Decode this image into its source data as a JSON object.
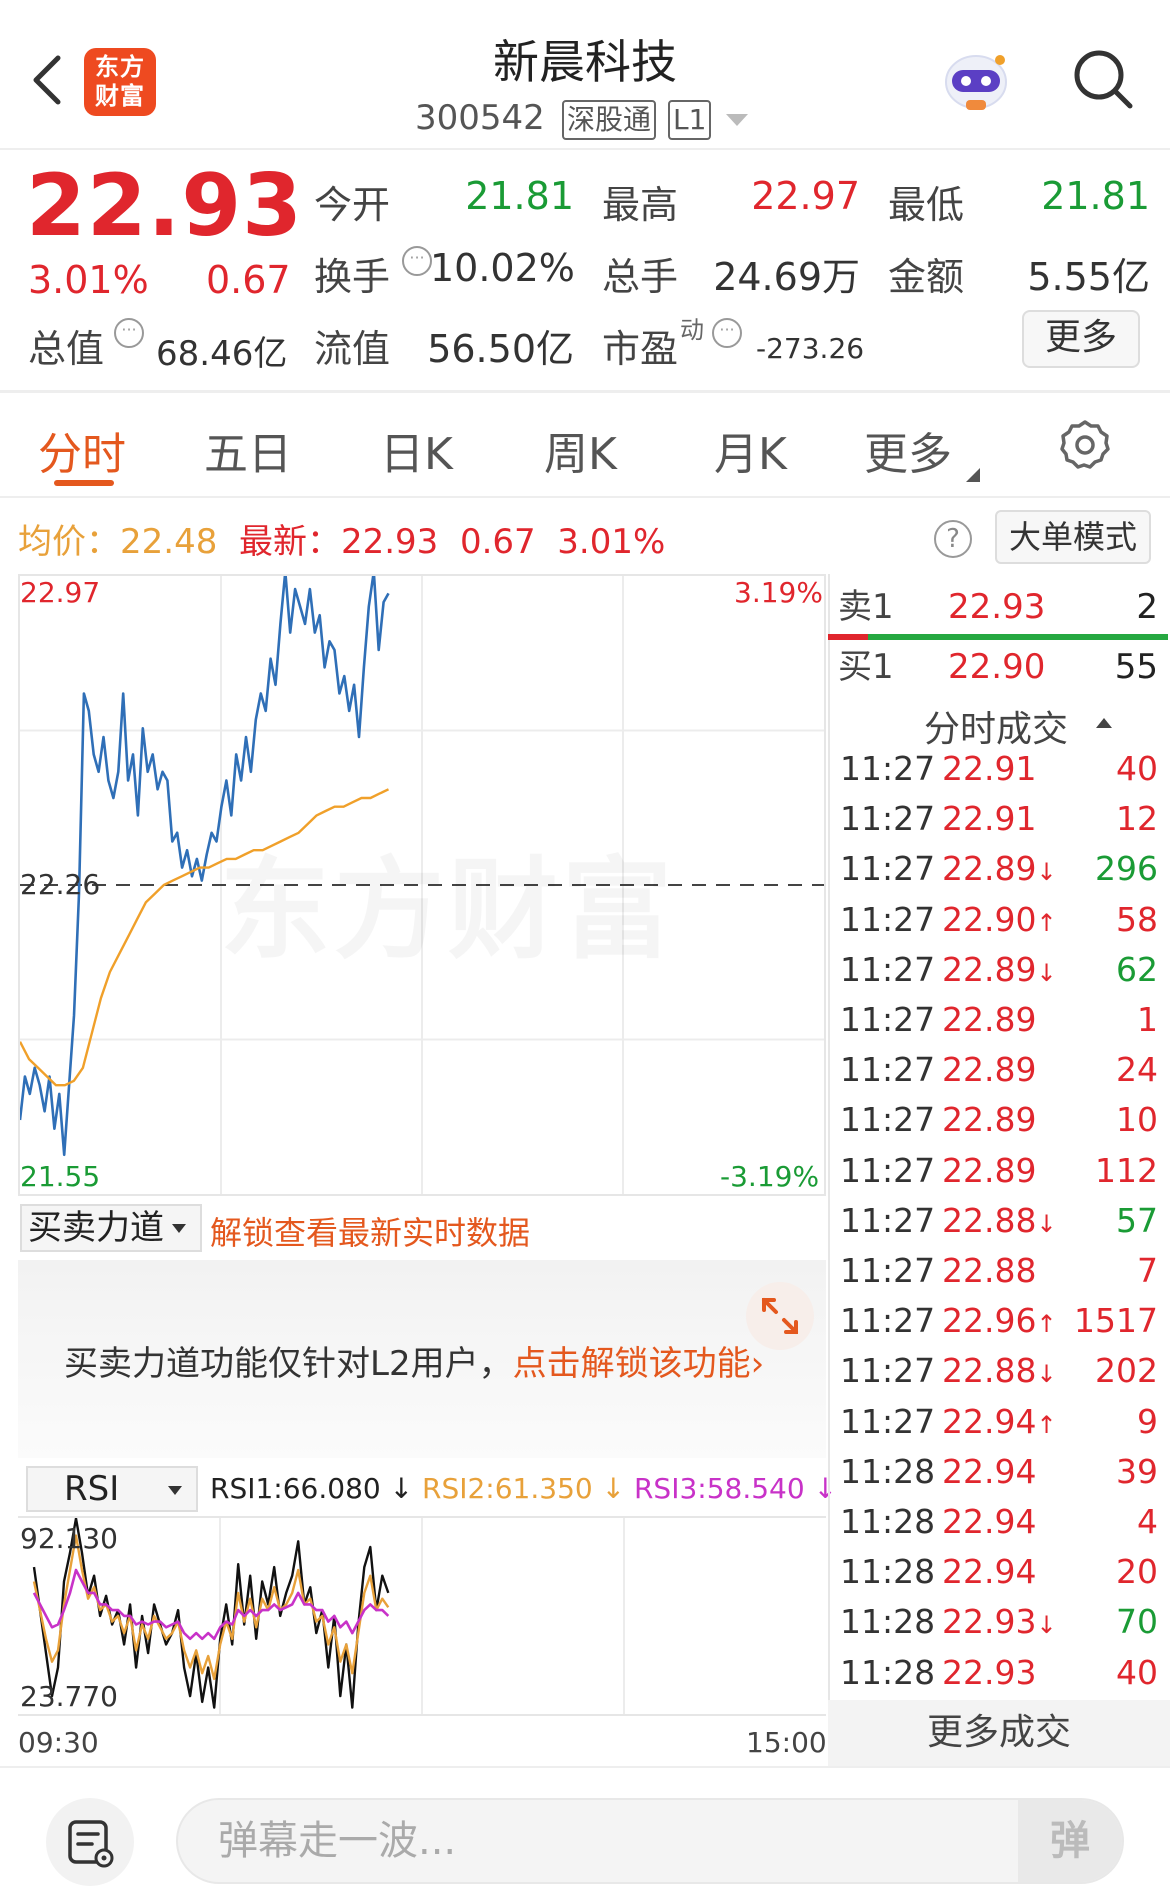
{
  "header": {
    "logo_text": "东方财富",
    "stock_name": "新晨科技",
    "stock_code": "300542",
    "tag_sgt": "深股通",
    "tag_level": "L1"
  },
  "quote": {
    "price": "22.93",
    "change_pct": "3.01%",
    "change_amt": "0.67",
    "labels": {
      "open": "今开",
      "high": "最高",
      "low": "最低",
      "turnover": "换手",
      "volume": "总手",
      "amount": "金额",
      "mktcap": "总值",
      "float_cap": "流值",
      "pe": "市盈",
      "pe_sup": "动"
    },
    "values": {
      "open": "21.81",
      "high": "22.97",
      "low": "21.81",
      "turnover": "10.02%",
      "volume": "24.69万",
      "amount": "5.55亿",
      "mktcap": "68.46亿",
      "float_cap": "56.50亿",
      "pe": "-273.26"
    },
    "more_label": "更多"
  },
  "tabs": [
    "分时",
    "五日",
    "日K",
    "周K",
    "月K",
    "更多"
  ],
  "summary": {
    "avg_label": "均价：",
    "avg_value": "22.48",
    "latest_label": "最新：",
    "latest_value": "22.93",
    "latest_change": "0.67",
    "latest_pct": "3.01%",
    "help_icon": "?",
    "bigorder_label": "大单模式"
  },
  "chart_data": {
    "type": "line",
    "y_max": "22.97",
    "y_min": "21.55",
    "y_ref": "22.26",
    "pct_max": "3.19%",
    "pct_min": "-3.19%",
    "ylim": [
      21.55,
      22.97
    ],
    "reference": 22.26,
    "x_start": "09:30",
    "x_end": "15:00",
    "series": [
      {
        "color": "#2f6fb7",
        "values": [
          21.72,
          21.82,
          21.78,
          21.84,
          21.8,
          21.74,
          21.82,
          21.7,
          21.78,
          21.64,
          21.8,
          21.96,
          22.24,
          22.7,
          22.66,
          22.56,
          22.52,
          22.6,
          22.5,
          22.46,
          22.52,
          22.7,
          22.5,
          22.56,
          22.42,
          22.62,
          22.52,
          22.56,
          22.48,
          22.52,
          22.5,
          22.36,
          22.38,
          22.3,
          22.34,
          22.28,
          22.32,
          22.27,
          22.33,
          22.38,
          22.36,
          22.44,
          22.5,
          22.42,
          22.56,
          22.5,
          22.6,
          22.52,
          22.64,
          22.7,
          22.66,
          22.78,
          22.72,
          22.86,
          22.98,
          22.84,
          22.94,
          22.9,
          22.86,
          22.94,
          22.84,
          22.88,
          22.76,
          22.82,
          22.8,
          22.7,
          22.74,
          22.66,
          22.72,
          22.6,
          22.76,
          22.9,
          22.98,
          22.8,
          22.91,
          22.93
        ]
      },
      {
        "color": "#f0a02a",
        "values": [
          21.9,
          21.86,
          21.84,
          21.82,
          21.8,
          21.8,
          21.81,
          21.84,
          21.92,
          22.0,
          22.06,
          22.1,
          22.14,
          22.18,
          22.22,
          22.24,
          22.26,
          22.27,
          22.28,
          22.29,
          22.3,
          22.3,
          22.31,
          22.32,
          22.32,
          22.33,
          22.34,
          22.34,
          22.35,
          22.36,
          22.37,
          22.38,
          22.4,
          22.42,
          22.43,
          22.44,
          22.44,
          22.45,
          22.46,
          22.46,
          22.47,
          22.48
        ]
      }
    ]
  },
  "bsf": {
    "select_label": "买卖力道",
    "unlock_link": "解锁查看最新实时数据",
    "msg": "买卖力道功能仅针对L2用户，",
    "msg_link": "点击解锁该功能",
    "msg_arrow": "›"
  },
  "rsi": {
    "select_label": "RSI",
    "rsi1": "RSI1:66.080 ↓",
    "rsi2": "RSI2:61.350 ↓",
    "rsi3": "RSI3:58.540 ↓",
    "y_max": "92.130",
    "y_min": "23.770",
    "colors": {
      "rsi1": "#111111",
      "rsi2": "#e8a13a",
      "rsi3": "#c832c8"
    },
    "series": [
      {
        "name": "RSI1",
        "values": [
          75,
          60,
          45,
          30,
          40,
          70,
          80,
          92,
          80,
          65,
          72,
          58,
          65,
          55,
          60,
          48,
          62,
          40,
          58,
          45,
          62,
          55,
          48,
          52,
          60,
          40,
          30,
          45,
          28,
          40,
          26,
          50,
          62,
          48,
          76,
          55,
          72,
          50,
          70,
          62,
          75,
          58,
          66,
          72,
          84,
          62,
          68,
          52,
          60,
          40,
          58,
          30,
          48,
          26,
          55,
          75,
          82,
          60,
          72,
          66
        ]
      },
      {
        "name": "RSI2",
        "values": [
          70,
          60,
          50,
          42,
          46,
          62,
          74,
          86,
          74,
          64,
          68,
          60,
          62,
          56,
          58,
          52,
          58,
          46,
          55,
          50,
          58,
          54,
          50,
          52,
          56,
          46,
          40,
          46,
          38,
          44,
          36,
          48,
          56,
          50,
          66,
          56,
          64,
          54,
          64,
          60,
          68,
          60,
          62,
          66,
          74,
          62,
          64,
          56,
          58,
          48,
          54,
          42,
          48,
          38,
          52,
          66,
          72,
          60,
          64,
          61
        ]
      },
      {
        "name": "RSI3",
        "values": [
          66,
          62,
          58,
          54,
          55,
          60,
          66,
          74,
          70,
          66,
          66,
          62,
          62,
          60,
          60,
          58,
          58,
          55,
          56,
          55,
          56,
          56,
          54,
          55,
          56,
          52,
          50,
          52,
          50,
          52,
          50,
          54,
          56,
          55,
          60,
          58,
          60,
          58,
          60,
          60,
          62,
          60,
          61,
          62,
          66,
          62,
          62,
          60,
          60,
          56,
          58,
          54,
          56,
          52,
          56,
          60,
          62,
          60,
          60,
          58
        ]
      }
    ]
  },
  "orderbook": {
    "sell": {
      "label": "卖1",
      "price": "22.93",
      "vol": "2"
    },
    "buy": {
      "label": "买1",
      "price": "22.90",
      "vol": "55"
    }
  },
  "trades": {
    "title": "分时成交",
    "rows": [
      {
        "time": "11:27",
        "price": "22.91",
        "arrow": "",
        "vol": "40",
        "dir": "up"
      },
      {
        "time": "11:27",
        "price": "22.91",
        "arrow": "",
        "vol": "12",
        "dir": "up"
      },
      {
        "time": "11:27",
        "price": "22.89",
        "arrow": "↓",
        "vol": "296",
        "dir": "down"
      },
      {
        "time": "11:27",
        "price": "22.90",
        "arrow": "↑",
        "vol": "58",
        "dir": "up"
      },
      {
        "time": "11:27",
        "price": "22.89",
        "arrow": "↓",
        "vol": "62",
        "dir": "down"
      },
      {
        "time": "11:27",
        "price": "22.89",
        "arrow": "",
        "vol": "1",
        "dir": "up"
      },
      {
        "time": "11:27",
        "price": "22.89",
        "arrow": "",
        "vol": "24",
        "dir": "up"
      },
      {
        "time": "11:27",
        "price": "22.89",
        "arrow": "",
        "vol": "10",
        "dir": "up"
      },
      {
        "time": "11:27",
        "price": "22.89",
        "arrow": "",
        "vol": "112",
        "dir": "up"
      },
      {
        "time": "11:27",
        "price": "22.88",
        "arrow": "↓",
        "vol": "57",
        "dir": "down"
      },
      {
        "time": "11:27",
        "price": "22.88",
        "arrow": "",
        "vol": "7",
        "dir": "up"
      },
      {
        "time": "11:27",
        "price": "22.96",
        "arrow": "↑",
        "vol": "1517",
        "dir": "up"
      },
      {
        "time": "11:27",
        "price": "22.88",
        "arrow": "↓",
        "vol": "202",
        "dir": "up"
      },
      {
        "time": "11:27",
        "price": "22.94",
        "arrow": "↑",
        "vol": "9",
        "dir": "up"
      },
      {
        "time": "11:28",
        "price": "22.94",
        "arrow": "",
        "vol": "39",
        "dir": "up"
      },
      {
        "time": "11:28",
        "price": "22.94",
        "arrow": "",
        "vol": "4",
        "dir": "up"
      },
      {
        "time": "11:28",
        "price": "22.94",
        "arrow": "",
        "vol": "20",
        "dir": "up"
      },
      {
        "time": "11:28",
        "price": "22.93",
        "arrow": "↓",
        "vol": "70",
        "dir": "down"
      },
      {
        "time": "11:28",
        "price": "22.93",
        "arrow": "",
        "vol": "40",
        "dir": "up"
      }
    ],
    "more_label": "更多成交"
  },
  "bottom": {
    "input_placeholder": "弹幕走一波...",
    "send_label": "弹"
  },
  "watermark": "东方财富"
}
